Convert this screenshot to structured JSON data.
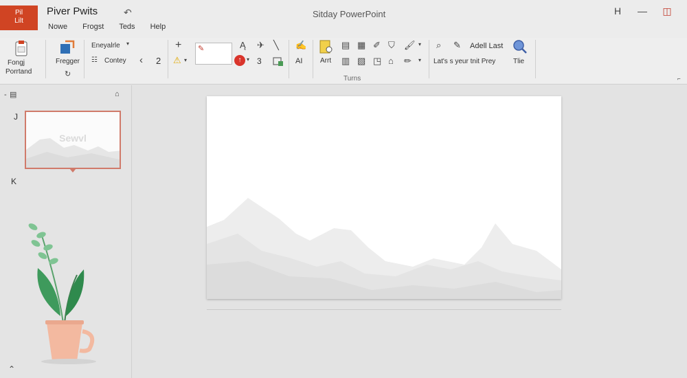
{
  "titlebar": {
    "logo_line1": "Pil",
    "logo_line2": "Lilt",
    "file_name": "Piver Pwits",
    "app_title": "Sitday PowerPoint",
    "btn_restore": "H",
    "btn_minimize": "—",
    "btn_close": "◫"
  },
  "menu": {
    "items": [
      "Nowe",
      "Frogst",
      "Teds",
      "Help"
    ]
  },
  "ribbon": {
    "paste_label_1": "Fongj",
    "paste_label_2": "Porrtand",
    "fregger_label": "Fregger",
    "font_name": "Eneyalrle",
    "font_size": "2",
    "style_label": "Contey",
    "nav_prev": "‹",
    "plus": "+",
    "num3": "3",
    "ai_label": "AI",
    "art_label": "Arrt",
    "turns_label": "Turns",
    "adell_label": "Adell Last",
    "lets_label": "Lat's s yeur tnit Prey",
    "tie_label": "Tlie"
  },
  "side": {
    "num_j": "J",
    "num_k": "K",
    "thumb_text": "Sewvl"
  },
  "colors": {
    "accent": "#d04423",
    "thumb_border": "#d07a6a",
    "leaf": "#3e9a5c",
    "pot": "#f3b9a0"
  }
}
